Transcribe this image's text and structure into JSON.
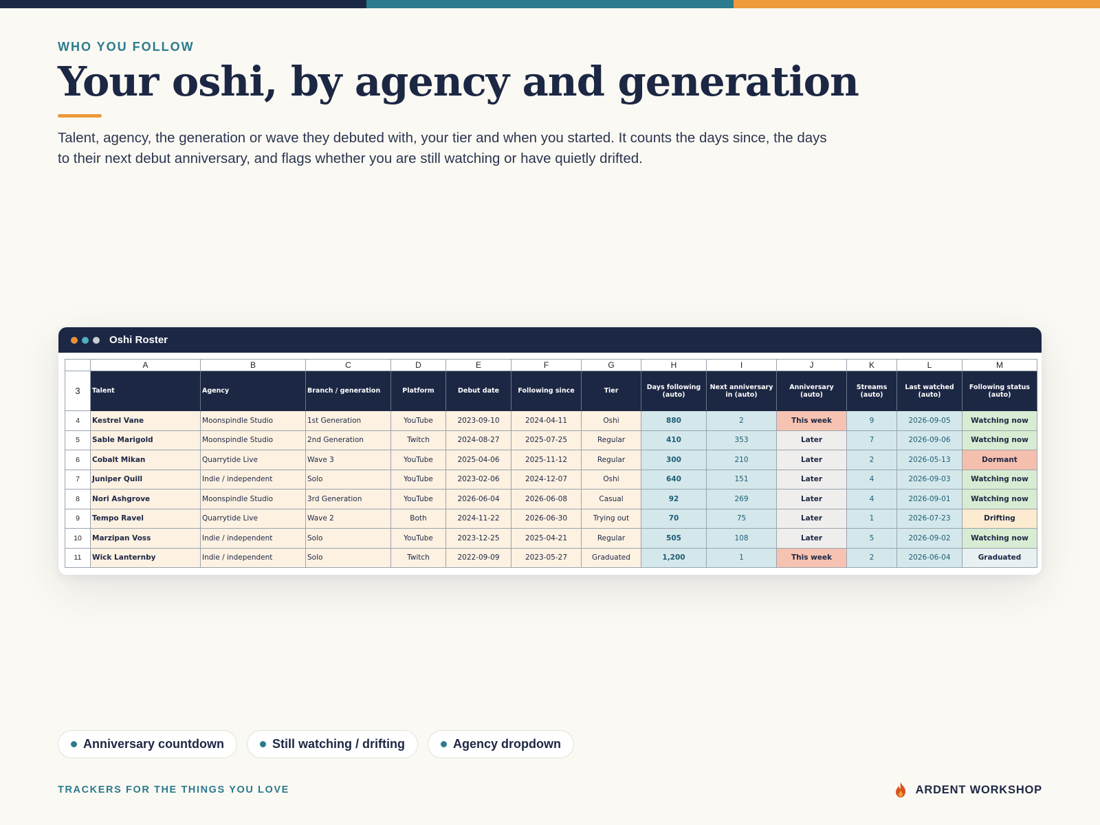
{
  "colors": {
    "navy": "#1c2744",
    "teal": "#2b7a8e",
    "orange": "#ec9a3c",
    "dot_orange": "#e8913a",
    "dot_teal": "#4fb0bf",
    "dot_gray": "#c9ccd2"
  },
  "header": {
    "eyebrow": "WHO YOU FOLLOW",
    "title": "Your oshi, by agency and generation",
    "description": "Talent, agency, the generation or wave they debuted with, your tier and when you started. It counts the days since, the days to their next debut anniversary, and flags whether you are still watching or have quietly drifted."
  },
  "window": {
    "title": "Oshi Roster"
  },
  "sheet": {
    "column_letters": [
      "A",
      "B",
      "C",
      "D",
      "E",
      "F",
      "G",
      "H",
      "I",
      "J",
      "K",
      "L",
      "M"
    ],
    "header_row_number": "3",
    "headers": [
      "Talent",
      "Agency",
      "Branch / generation",
      "Platform",
      "Debut date",
      "Following since",
      "Tier",
      "Days following (auto)",
      "Next anniversary in (auto)",
      "Anniversary (auto)",
      "Streams (auto)",
      "Last watched (auto)",
      "Following status (auto)"
    ],
    "rows": [
      {
        "n": "4",
        "talent": "Kestrel Vane",
        "agency": "Moonspindle Studio",
        "branch": "1st Generation",
        "platform": "YouTube",
        "debut": "2023-09-10",
        "since": "2024-04-11",
        "tier": "Oshi",
        "days": "880",
        "next": "2",
        "anniv": "This week",
        "streams": "9",
        "last": "2026-09-05",
        "status": "Watching now"
      },
      {
        "n": "5",
        "talent": "Sable Marigold",
        "agency": "Moonspindle Studio",
        "branch": "2nd Generation",
        "platform": "Twitch",
        "debut": "2024-08-27",
        "since": "2025-07-25",
        "tier": "Regular",
        "days": "410",
        "next": "353",
        "anniv": "Later",
        "streams": "7",
        "last": "2026-09-06",
        "status": "Watching now"
      },
      {
        "n": "6",
        "talent": "Cobalt Mikan",
        "agency": "Quarrytide Live",
        "branch": "Wave 3",
        "platform": "YouTube",
        "debut": "2025-04-06",
        "since": "2025-11-12",
        "tier": "Regular",
        "days": "300",
        "next": "210",
        "anniv": "Later",
        "streams": "2",
        "last": "2026-05-13",
        "status": "Dormant"
      },
      {
        "n": "7",
        "talent": "Juniper Quill",
        "agency": "Indie / independent",
        "branch": "Solo",
        "platform": "YouTube",
        "debut": "2023-02-06",
        "since": "2024-12-07",
        "tier": "Oshi",
        "days": "640",
        "next": "151",
        "anniv": "Later",
        "streams": "4",
        "last": "2026-09-03",
        "status": "Watching now"
      },
      {
        "n": "8",
        "talent": "Nori Ashgrove",
        "agency": "Moonspindle Studio",
        "branch": "3rd Generation",
        "platform": "YouTube",
        "debut": "2026-06-04",
        "since": "2026-06-08",
        "tier": "Casual",
        "days": "92",
        "next": "269",
        "anniv": "Later",
        "streams": "4",
        "last": "2026-09-01",
        "status": "Watching now"
      },
      {
        "n": "9",
        "talent": "Tempo Ravel",
        "agency": "Quarrytide Live",
        "branch": "Wave 2",
        "platform": "Both",
        "debut": "2024-11-22",
        "since": "2026-06-30",
        "tier": "Trying out",
        "days": "70",
        "next": "75",
        "anniv": "Later",
        "streams": "1",
        "last": "2026-07-23",
        "status": "Drifting"
      },
      {
        "n": "10",
        "talent": "Marzipan Voss",
        "agency": "Indie / independent",
        "branch": "Solo",
        "platform": "YouTube",
        "debut": "2023-12-25",
        "since": "2025-04-21",
        "tier": "Regular",
        "days": "505",
        "next": "108",
        "anniv": "Later",
        "streams": "5",
        "last": "2026-09-02",
        "status": "Watching now"
      },
      {
        "n": "11",
        "talent": "Wick Lanternby",
        "agency": "Indie / independent",
        "branch": "Solo",
        "platform": "Twitch",
        "debut": "2022-09-09",
        "since": "2023-05-27",
        "tier": "Graduated",
        "days": "1,200",
        "next": "1",
        "anniv": "This week",
        "streams": "2",
        "last": "2026-06-04",
        "status": "Graduated"
      }
    ]
  },
  "chips": [
    "Anniversary countdown",
    "Still watching / drifting",
    "Agency dropdown"
  ],
  "footer": {
    "tagline": "TRACKERS FOR THE THINGS YOU LOVE",
    "brand": "ARDENT WORKSHOP",
    "brand_icon": "flame-icon"
  }
}
